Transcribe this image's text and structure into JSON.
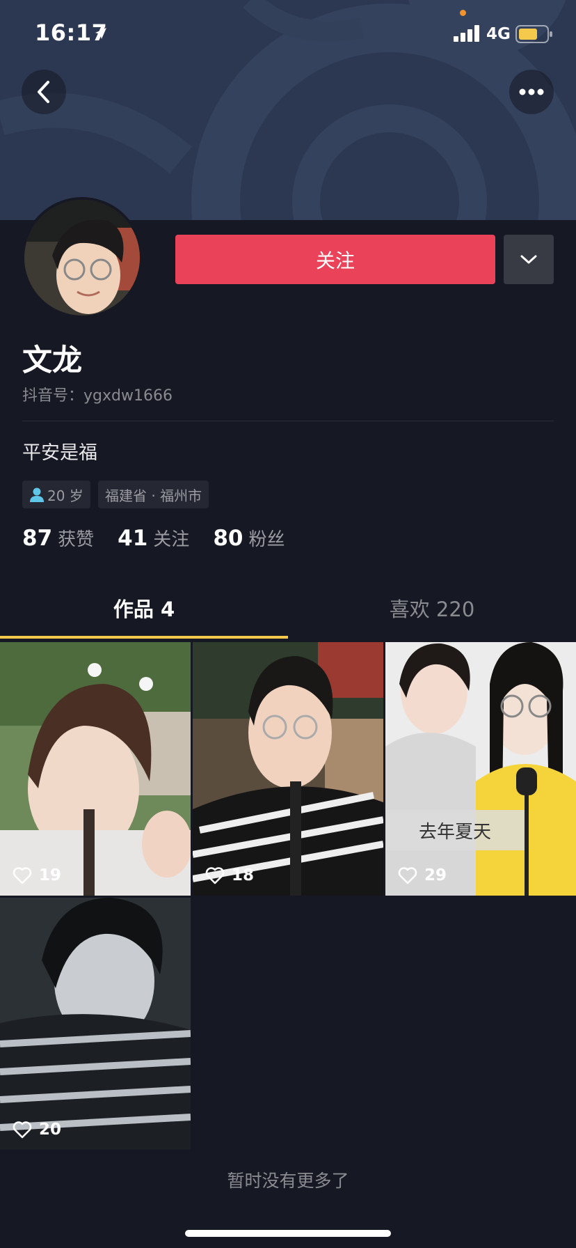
{
  "status_bar": {
    "time": "16:17",
    "network": "4G",
    "icons": [
      "location-arrow-icon",
      "signal-icon",
      "battery-icon"
    ],
    "battery_color": "#f5c94b"
  },
  "header": {
    "back_icon": "chevron-left-icon",
    "more_icon": "more-dots-icon"
  },
  "profile": {
    "follow_label": "关注",
    "nickname": "文龙",
    "douyin_id": "抖音号：ygxdw1666",
    "bio": "平安是福",
    "age_tag": "20 岁",
    "location_tag": "福建省 · 福州市",
    "stats": [
      {
        "num": "87",
        "label": "获赞"
      },
      {
        "num": "41",
        "label": "关注"
      },
      {
        "num": "80",
        "label": "粉丝"
      }
    ]
  },
  "tabs": [
    {
      "label": "作品 4",
      "active": true
    },
    {
      "label": "喜欢 220",
      "active": false
    }
  ],
  "videos": [
    {
      "likes": "19"
    },
    {
      "likes": "18"
    },
    {
      "likes": "29",
      "caption": "去年夏天"
    },
    {
      "likes": "20"
    }
  ],
  "footer": {
    "no_more": "暂时没有更多了"
  },
  "colors": {
    "background": "#161823",
    "follow_button": "#ea4359",
    "tab_indicator": "#f5c94b",
    "banner": "#2c3851"
  }
}
